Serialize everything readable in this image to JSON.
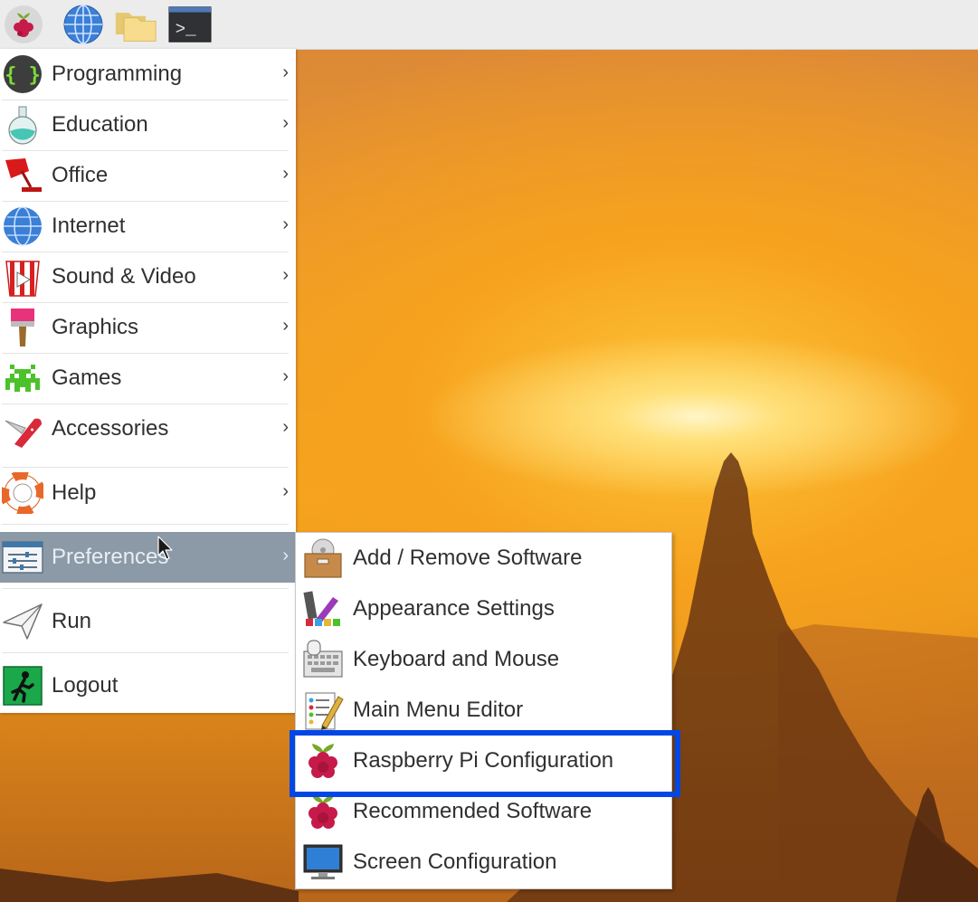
{
  "taskbar": {
    "buttons": [
      {
        "icon": "raspberry-menu-icon"
      },
      {
        "icon": "web-browser-icon"
      },
      {
        "icon": "file-manager-icon"
      },
      {
        "icon": "terminal-icon",
        "prompt": ">_"
      }
    ]
  },
  "main_menu": {
    "items": [
      {
        "label": "Programming",
        "icon": "programming-icon",
        "glyph": "{ }",
        "submenu": true
      },
      {
        "label": "Education",
        "icon": "education-flask-icon",
        "submenu": true
      },
      {
        "label": "Office",
        "icon": "office-lamp-icon",
        "submenu": true
      },
      {
        "label": "Internet",
        "icon": "internet-globe-icon",
        "submenu": true
      },
      {
        "label": "Sound & Video",
        "icon": "sound-video-popcorn-icon",
        "submenu": true
      },
      {
        "label": "Graphics",
        "icon": "graphics-brush-icon",
        "submenu": true
      },
      {
        "label": "Games",
        "icon": "games-invader-icon",
        "submenu": true
      },
      {
        "label": "Accessories",
        "icon": "accessories-knife-icon",
        "submenu": true
      },
      {
        "label": "Help",
        "icon": "help-lifebuoy-icon",
        "submenu": true
      },
      {
        "label": "Preferences",
        "icon": "preferences-sliders-icon",
        "submenu": true,
        "selected": true
      },
      {
        "label": "Run",
        "icon": "run-paper-plane-icon",
        "submenu": false
      },
      {
        "label": "Logout",
        "icon": "logout-exit-icon",
        "submenu": false
      }
    ],
    "arrow": "›"
  },
  "preferences_submenu": {
    "items": [
      {
        "label": "Add / Remove Software",
        "icon": "software-package-icon"
      },
      {
        "label": "Appearance Settings",
        "icon": "appearance-palette-icon"
      },
      {
        "label": "Keyboard and Mouse",
        "icon": "keyboard-mouse-icon"
      },
      {
        "label": "Main Menu Editor",
        "icon": "menu-editor-icon"
      },
      {
        "label": "Raspberry Pi Configuration",
        "icon": "raspberry-pi-icon",
        "highlighted": true
      },
      {
        "label": "Recommended Software",
        "icon": "raspberry-pi-icon"
      },
      {
        "label": "Screen Configuration",
        "icon": "monitor-icon"
      }
    ]
  },
  "colors": {
    "selected_bg": "#8c9aa7",
    "highlight_border": "#0047e6",
    "wallpaper_sun": "#ffe07a",
    "raspberry_red": "#c51a4a",
    "raspberry_leaf": "#75a928"
  }
}
